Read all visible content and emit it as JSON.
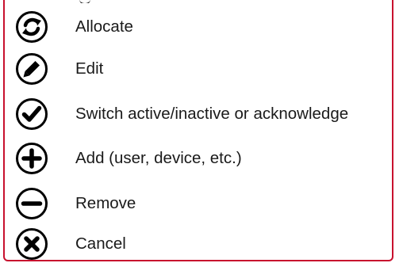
{
  "legend": {
    "items": [
      {
        "icon": "refresh-icon",
        "label": "Allocate"
      },
      {
        "icon": "pencil-icon",
        "label": "Edit"
      },
      {
        "icon": "checkmark-icon",
        "label": "Switch active/inactive or acknowledge"
      },
      {
        "icon": "plus-icon",
        "label": "Add (user, device, etc.)"
      },
      {
        "icon": "minus-icon",
        "label": "Remove"
      },
      {
        "icon": "close-icon",
        "label": "Cancel"
      }
    ]
  },
  "colors": {
    "border": "#c8102e",
    "icon": "#000000",
    "text": "#1a1a1a"
  }
}
